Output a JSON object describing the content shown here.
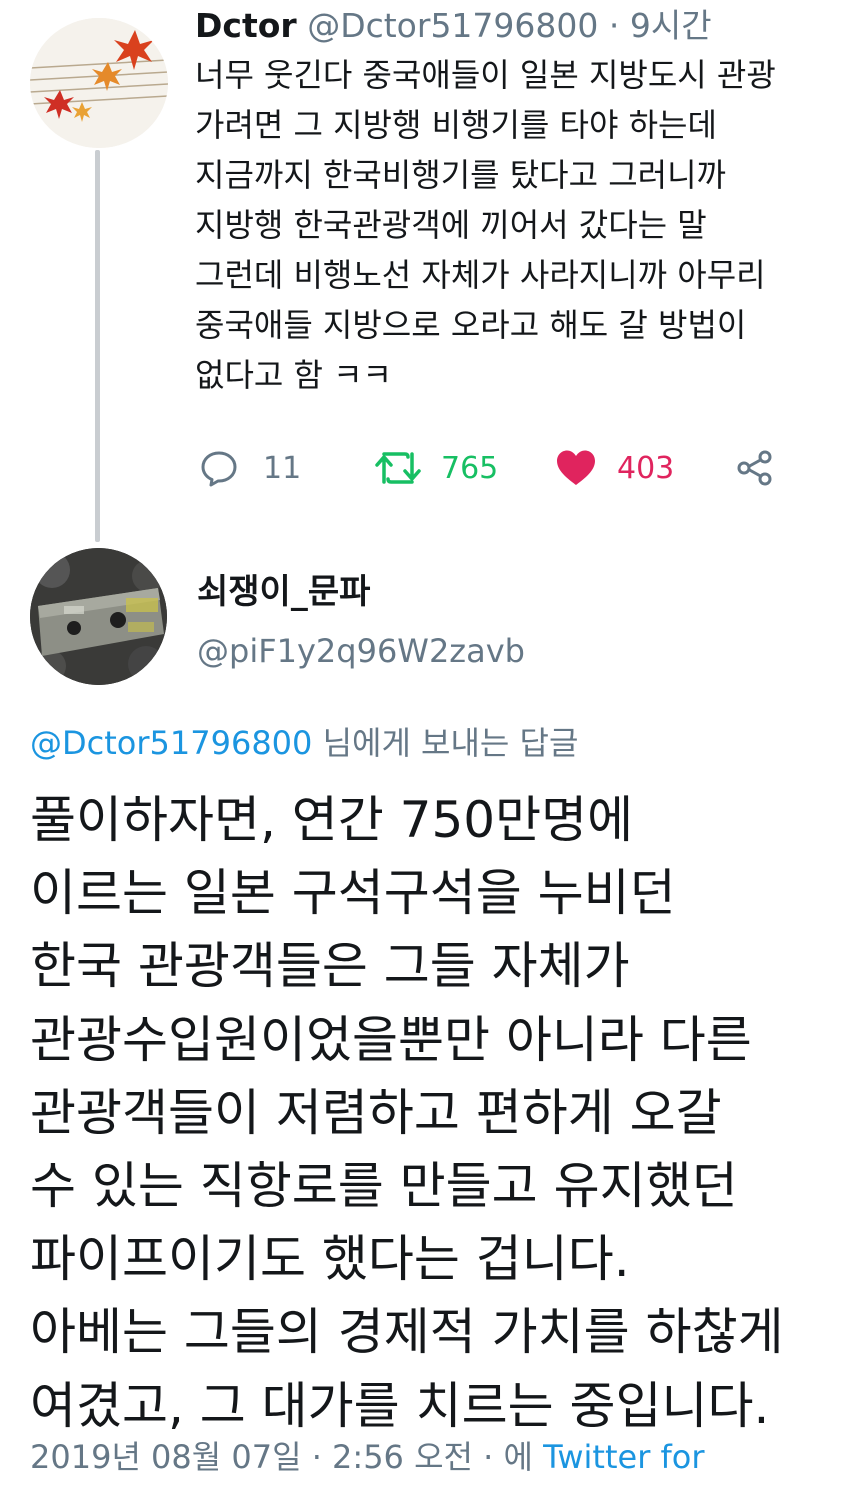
{
  "colors": {
    "link_blue": "#1b95e0",
    "secondary_gray": "#657786",
    "retweet_green": "#17bf63",
    "like_red": "#e0245e",
    "thread_line": "#c9cdd1"
  },
  "parent_tweet": {
    "display_name": "Dctor",
    "handle": "@Dctor51796800",
    "separator": "·",
    "time": "9시간",
    "body_lines": [
      "너무 웃긴다 중국애들이 일본 지방도시 관광",
      "가려면 그 지방행 비행기를 타야 하는데",
      "지금까지 한국비행기를 탔다고 그러니까",
      "지방행 한국관광객에 끼어서 갔다는 말",
      "그런데 비행노선 자체가 사라지니까 아무리",
      "중국애들 지방으로 오라고 해도 갈 방법이",
      "없다고 함 ㅋㅋ"
    ],
    "actions": {
      "reply_icon": "reply-bubble-icon",
      "reply_count": "11",
      "retweet_icon": "retweet-icon",
      "retweet_count": "765",
      "like_icon": "heart-filled-icon",
      "like_count": "403",
      "share_icon": "share-nodes-icon"
    }
  },
  "reply_tweet": {
    "display_name": "쇠쟁이_문파",
    "handle": "@piF1y2q96W2zavb",
    "replying_mention": "@Dctor51796800",
    "replying_suffix": " 님에게 보내는 답글",
    "body_lines": [
      "풀이하자면, 연간 750만명에",
      "이르는 일본 구석구석을 누비던",
      "한국 관광객들은 그들 자체가",
      "관광수입원이었을뿐만 아니라 다른",
      "관광객들이 저렴하고 편하게 오갈",
      "수 있는 직항로를 만들고 유지했던",
      "파이프이기도 했다는 겁니다.",
      "아베는 그들의 경제적 가치를 하찮게",
      "여겼고, 그 대가를 치르는 중입니다."
    ],
    "meta_date": "2019년 08월 07일 · 2:56 오전 · 에",
    "meta_via": " Twitter for"
  }
}
